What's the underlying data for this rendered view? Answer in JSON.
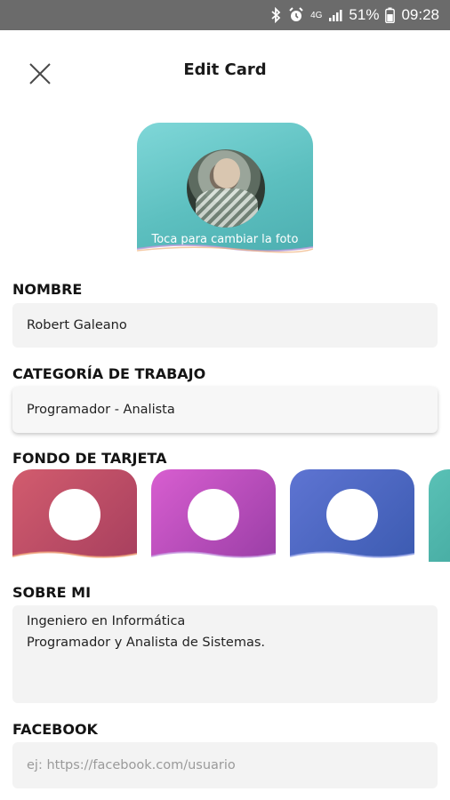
{
  "status_bar": {
    "battery_text": "51%",
    "time": "09:28",
    "network": "4G",
    "icons": [
      "bluetooth-icon",
      "alarm-icon",
      "signal-icon",
      "battery-icon"
    ]
  },
  "header": {
    "title": "Edit Card",
    "close_icon": "close-icon"
  },
  "photo": {
    "change_text": "Toca para cambiar la foto",
    "color": "#5cbfbf"
  },
  "form": {
    "name": {
      "label": "NOMBRE",
      "value": "Robert Galeano"
    },
    "category": {
      "label": "CATEGORÍA DE TRABAJO",
      "value": "Programador - Analista"
    },
    "background": {
      "label": "FONDO DE TARJETA",
      "options": [
        {
          "id": "red",
          "colors": [
            "#d25c6e",
            "#a73f5e"
          ]
        },
        {
          "id": "purple",
          "colors": [
            "#d85ed0",
            "#9a3ea6"
          ]
        },
        {
          "id": "blue",
          "colors": [
            "#5e74d2",
            "#3c5bb1"
          ]
        },
        {
          "id": "teal",
          "colors": [
            "#5ac1b6",
            "#3a9e96"
          ]
        }
      ]
    },
    "about": {
      "label": "SOBRE MI",
      "lines": [
        "Ingeniero en Informática",
        "Programador y Analista de Sistemas."
      ]
    },
    "facebook": {
      "label": "FACEBOOK",
      "placeholder": "ej: https://facebook.com/usuario"
    }
  }
}
